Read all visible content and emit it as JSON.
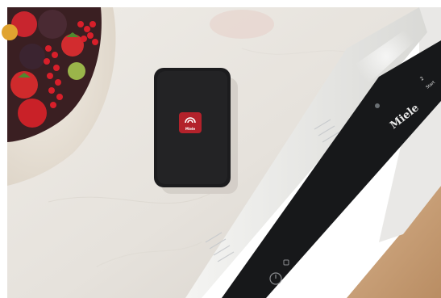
{
  "scene": {
    "description_free": true,
    "colors": {
      "countertop": "#e8e4de",
      "phone_body": "#1c1c1e",
      "app_icon": "#b3222b",
      "fascia": "#17181a",
      "floor_wood": "#c9a27a"
    }
  },
  "phone": {
    "app_label": "Miele"
  },
  "dishwasher": {
    "brand_label": "Miele",
    "panel_labels": [
      "2",
      "Start"
    ]
  },
  "icons": {
    "app_icon": "miele-app-wifi-icon",
    "power": "power-icon",
    "door": "door-open-icon"
  }
}
